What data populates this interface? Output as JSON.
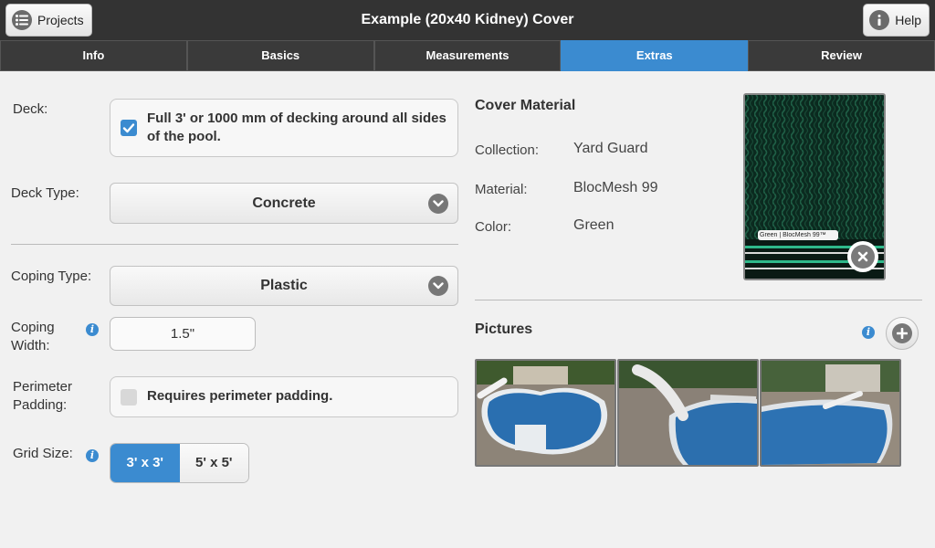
{
  "header": {
    "title": "Example (20x40 Kidney) Cover",
    "projects_label": "Projects",
    "help_label": "Help"
  },
  "tabs": [
    {
      "label": "Info",
      "active": false
    },
    {
      "label": "Basics",
      "active": false
    },
    {
      "label": "Measurements",
      "active": false
    },
    {
      "label": "Extras",
      "active": true
    },
    {
      "label": "Review",
      "active": false
    }
  ],
  "form": {
    "deck_label": "Deck:",
    "deck_checkbox_text": "Full 3' or 1000 mm of decking around all sides of the pool.",
    "deck_checked": true,
    "deck_type_label": "Deck Type:",
    "deck_type_value": "Concrete",
    "coping_type_label": "Coping Type:",
    "coping_type_value": "Plastic",
    "coping_width_label": "Coping Width:",
    "coping_width_value": "1.5\"",
    "perimeter_label": "Perimeter Padding:",
    "perimeter_checkbox_text": "Requires perimeter padding.",
    "perimeter_checked": false,
    "grid_size_label": "Grid Size:",
    "grid_options": [
      "3' x 3'",
      "5' x 5'"
    ],
    "grid_selected": "3' x 3'"
  },
  "cover_material": {
    "heading": "Cover Material",
    "collection_label": "Collection:",
    "collection_value": "Yard Guard",
    "material_label": "Material:",
    "material_value": "BlocMesh 99",
    "color_label": "Color:",
    "color_value": "Green",
    "swatch_tag": "Green | BlocMesh 99™"
  },
  "pictures": {
    "heading": "Pictures"
  },
  "colors": {
    "accent": "#3b8bd0",
    "header_bg": "#333333",
    "page_bg": "#f1f1f1"
  }
}
